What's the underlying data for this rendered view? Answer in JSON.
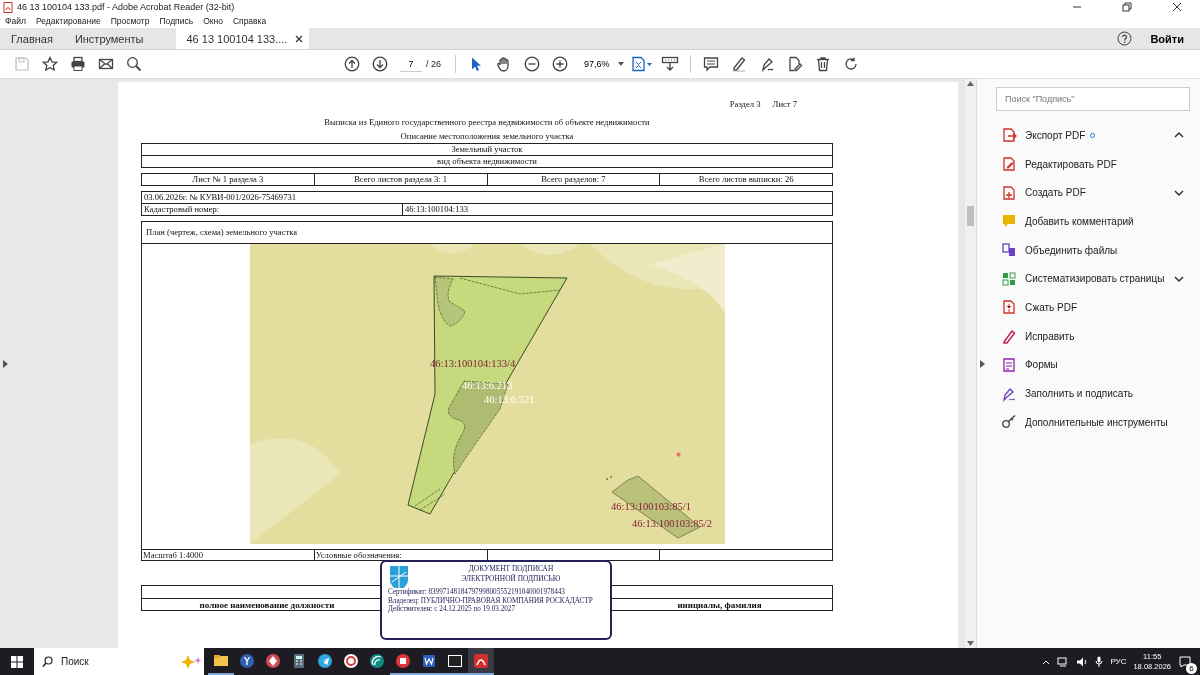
{
  "window": {
    "title": "46 13 100104 133.pdf - Adobe Acrobat Reader (32-bit)"
  },
  "menu": [
    "Файл",
    "Редактирование",
    "Просмотр",
    "Подпись",
    "Окно",
    "Справка"
  ],
  "tabs": [
    {
      "label": "Главная",
      "selected": false,
      "closable": false
    },
    {
      "label": "Инструменты",
      "selected": false,
      "closable": false
    },
    {
      "label": "46 13 100104 133....",
      "selected": true,
      "closable": true
    }
  ],
  "sign_in": "Войти",
  "toolbar": {
    "page": "7",
    "pages": "/ 26",
    "zoom": "97,6%",
    "select_tool_active": true,
    "save_disabled": true
  },
  "document": {
    "section": "Раздел 3",
    "sheet": "Лист 7",
    "title": "Выписка из Единого государственного реестра недвижимости об объекте недвижимости",
    "subtitle": "Описание местоположения земельного участка",
    "object_type": "Земельный участок",
    "object_type_caption": "вид объекта недвижимости",
    "sheet_info": [
      "Лист № 1 раздела 3",
      "Всего листов раздела 3: 1",
      "Всего разделов: 7",
      "Всего листов выписки: 26"
    ],
    "record": "03.06.2026г. № КУВИ-001/2026-75469731",
    "cadastral": {
      "label": "Кадастровый номер:",
      "value": "46:13:100104:133"
    },
    "plan_title": "План (чертеж, схема) земельного участка",
    "map_labels": [
      {
        "text": "46:13:100104:133/4",
        "kind": "parcel"
      },
      {
        "text": "46:13:6.213",
        "kind": "zone"
      },
      {
        "text": "46:13:6.321",
        "kind": "zone"
      },
      {
        "text": "46:13:100103:85/1",
        "kind": "parcel"
      },
      {
        "text": "46:13:100103:85/2",
        "kind": "parcel"
      }
    ],
    "scale": "Масштаб 1:4000",
    "legend": "Условные обозначения:",
    "signature_captions": [
      "полное наименование должности",
      "инициалы, фамилия"
    ],
    "stamp": {
      "heading": [
        "ДОКУМЕНТ ПОДПИСАН",
        "ЭЛЕКТРОННОЙ ПОДПИСЬЮ"
      ],
      "certificate": "Сертификат: 83997148184797998005552191040001978443",
      "owner": "Владелец: ПУБЛИЧНО-ПРАВОВАЯ КОМПАНИЯ РОСКАДАСТР",
      "validity": "Действителен: с 24.12.2025 по 19.03.2027"
    }
  },
  "side_panel": {
    "search_placeholder": "Поиск \"Подпись\"",
    "tools": [
      {
        "label": "Экспорт PDF",
        "badge": true,
        "expandable": true,
        "expanded": true
      },
      {
        "label": "Редактировать PDF",
        "badge": false,
        "expandable": false
      },
      {
        "label": "Создать PDF",
        "badge": false,
        "expandable": true,
        "expanded": false
      },
      {
        "label": "Добавить комментарий",
        "badge": false,
        "expandable": false
      },
      {
        "label": "Объединить файлы",
        "badge": false,
        "expandable": false
      },
      {
        "label": "Систематизировать страницы",
        "badge": false,
        "expandable": true,
        "expanded": false
      },
      {
        "label": "Сжать PDF",
        "badge": false,
        "expandable": false
      },
      {
        "label": "Исправить",
        "badge": false,
        "expandable": false
      },
      {
        "label": "Формы",
        "badge": false,
        "expandable": false
      },
      {
        "label": "Заполнить и подписать",
        "badge": false,
        "expandable": false
      },
      {
        "label": "Дополнительные инструменты",
        "badge": false,
        "expandable": false
      }
    ]
  },
  "taskbar": {
    "search_placeholder": "Поиск",
    "language": "РУС",
    "time": "11:55",
    "date": "18.08.2026",
    "notifications": "6"
  }
}
